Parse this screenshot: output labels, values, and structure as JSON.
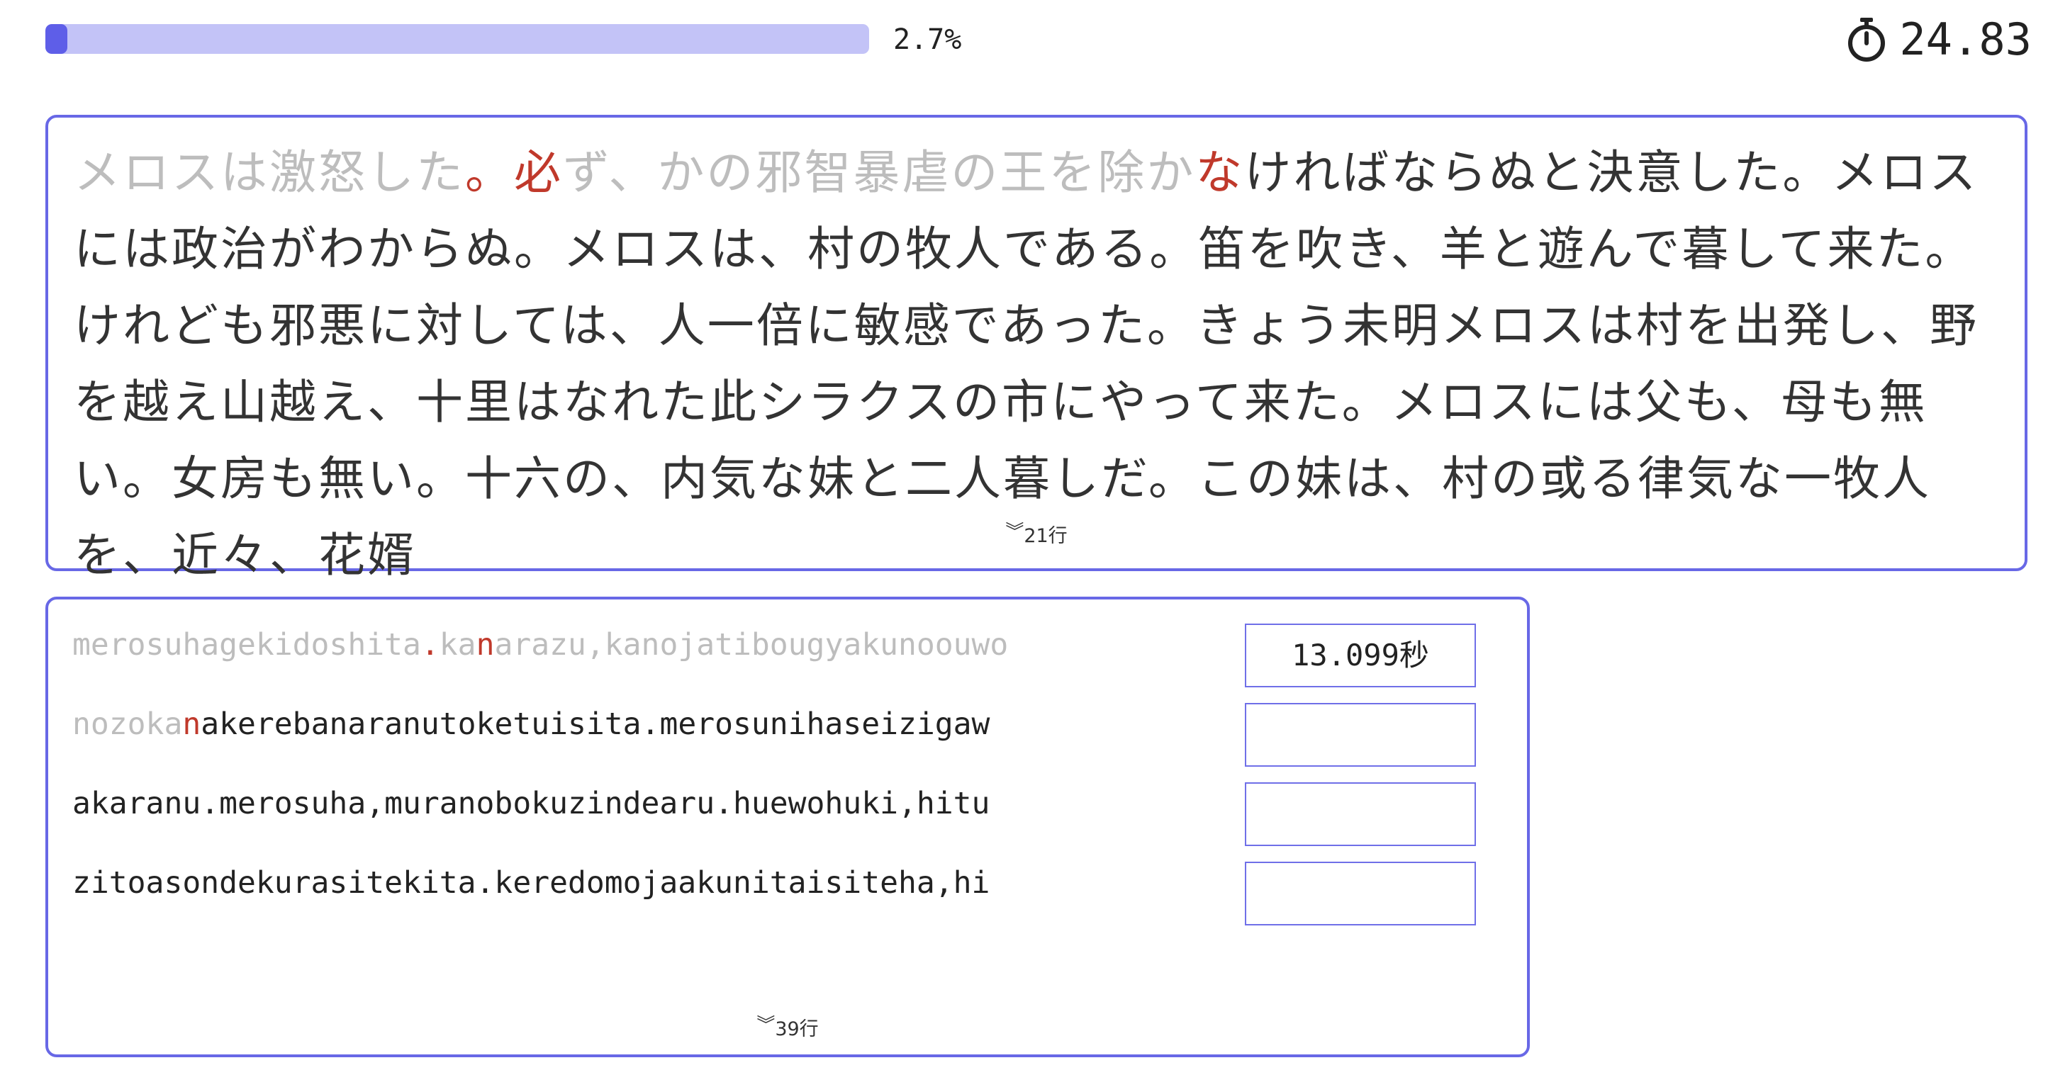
{
  "progress": {
    "fraction": 0.027,
    "label": "2.7%"
  },
  "timer": {
    "value": "24.83",
    "icon": "stopwatch-icon"
  },
  "kanji": {
    "typed": "メロスは激怒した",
    "typed_mark": "。",
    "current": "必",
    "lookahead_typed": "ず、かの邪智暴虐の王を除か",
    "lookahead_current": "な",
    "rest": "ければならぬと決意した。メロスには政治がわからぬ。メロスは、村の牧人である。笛を吹き、羊と遊んで暮して来た。けれども邪悪に対しては、人一倍に敏感であった。きょう未明メロスは村を出発し、野を越え山越え、十里はなれた此シラクスの市にやって来た。メロスには父も、母も無い。女房も無い。十六の、内気な妹と二人暮しだ。この妹は、村の或る律気な一牧人を、近々、花婿",
    "line_count": "21行"
  },
  "roman": {
    "lines": [
      {
        "typed": "merosuhagekidoshita",
        "typed_mark": ".",
        "mid_typed": "ka",
        "current": "n",
        "rest": "arazu,kanojatibougyakunoouwo",
        "time": "13.099秒"
      },
      {
        "typed": "nozoka",
        "typed_mark": "",
        "mid_typed": "",
        "current": "n",
        "rest": "akerebanaranutoketuisita.merosunihaseizigaw",
        "time": ""
      },
      {
        "typed": "",
        "typed_mark": "",
        "mid_typed": "",
        "current": "",
        "rest": "akaranu.merosuha,muranobokuzindearu.huewohuki,hitu",
        "time": ""
      },
      {
        "typed": "",
        "typed_mark": "",
        "mid_typed": "",
        "current": "",
        "rest": "zitoasondekurasitekita.keredomojaakunitaisiteha,hi",
        "time": ""
      }
    ],
    "line_count": "39行"
  },
  "colors": {
    "accent": "#6868e6",
    "progress_track": "#c3c3f7",
    "progress_fill": "#5e5ee8",
    "error": "#c0392b",
    "typed": "#bdbdbd"
  }
}
